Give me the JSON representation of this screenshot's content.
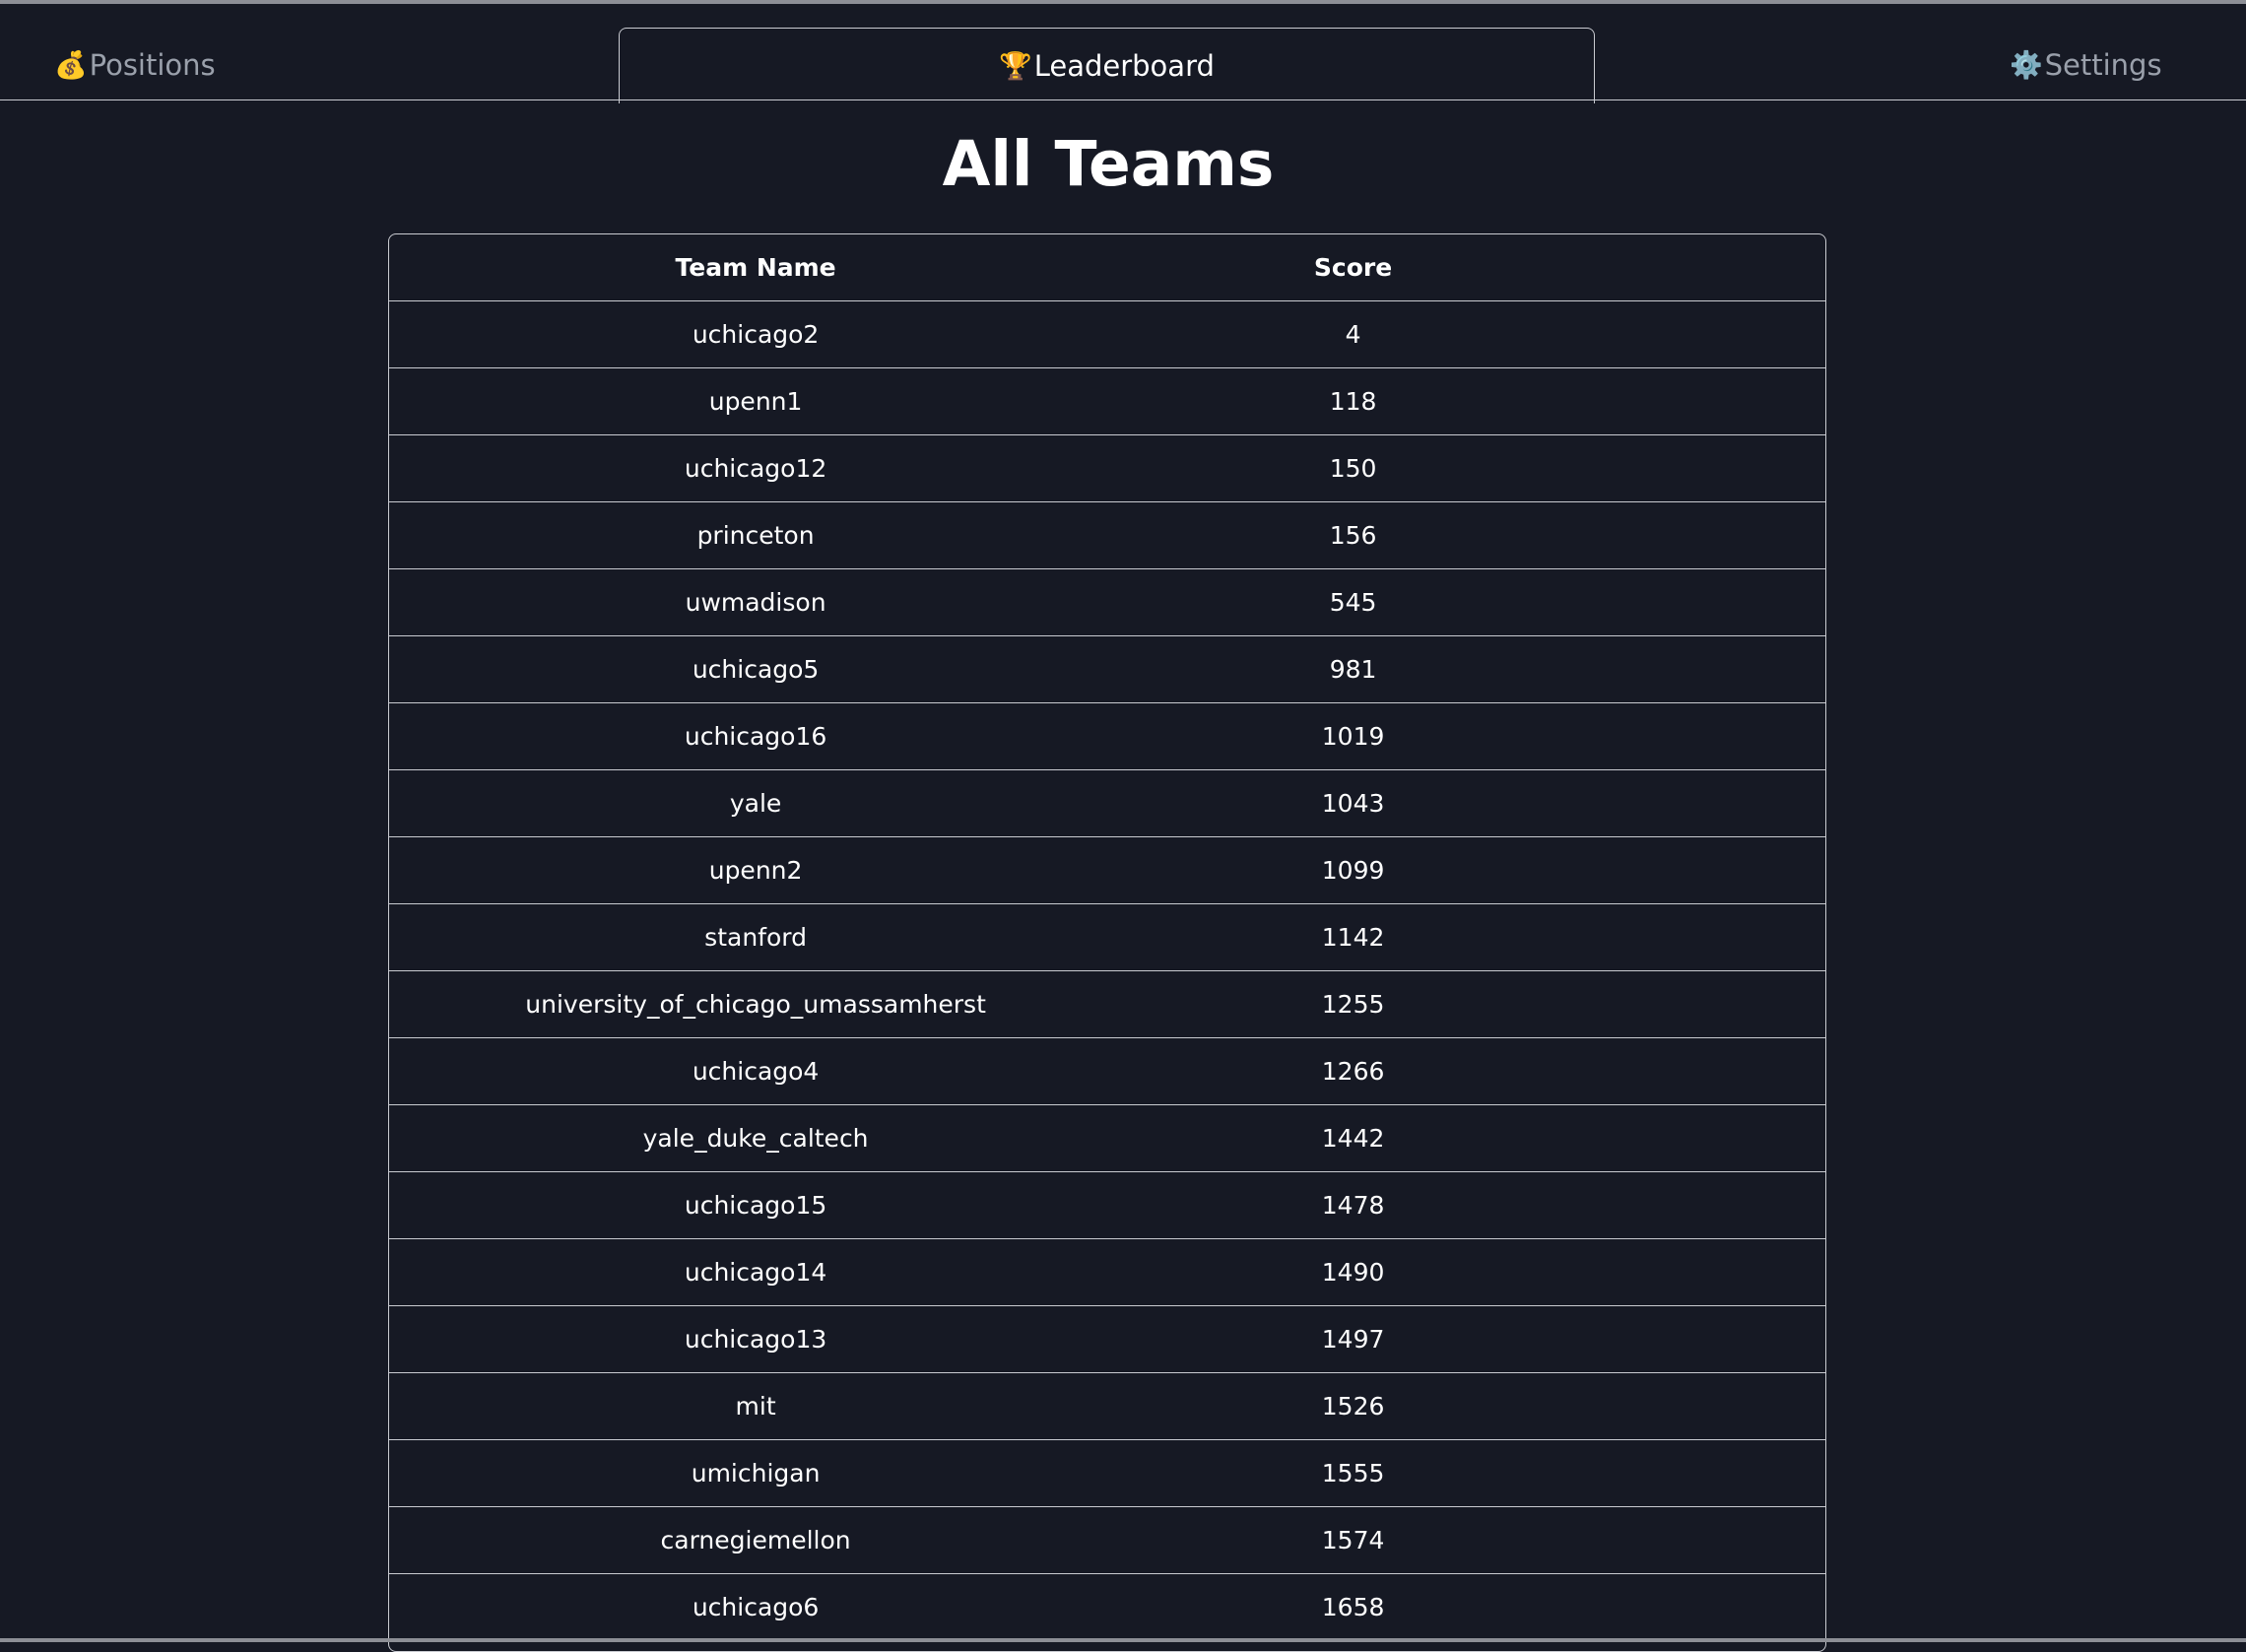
{
  "nav": {
    "tabs": [
      {
        "icon": "💰",
        "icon_name": "money-bag-icon",
        "label": "Positions",
        "active": false
      },
      {
        "icon": "🏆",
        "icon_name": "trophy-icon",
        "label": "Leaderboard",
        "active": true
      },
      {
        "icon": "⚙️",
        "icon_name": "gear-icon",
        "label": "Settings",
        "active": false
      }
    ]
  },
  "page": {
    "title": "All Teams"
  },
  "table": {
    "headers": [
      "Team Name",
      "Score"
    ],
    "rows": [
      [
        "uchicago2",
        "4"
      ],
      [
        "upenn1",
        "118"
      ],
      [
        "uchicago12",
        "150"
      ],
      [
        "princeton",
        "156"
      ],
      [
        "uwmadison",
        "545"
      ],
      [
        "uchicago5",
        "981"
      ],
      [
        "uchicago16",
        "1019"
      ],
      [
        "yale",
        "1043"
      ],
      [
        "upenn2",
        "1099"
      ],
      [
        "stanford",
        "1142"
      ],
      [
        "university_of_chicago_umassamherst",
        "1255"
      ],
      [
        "uchicago4",
        "1266"
      ],
      [
        "yale_duke_caltech",
        "1442"
      ],
      [
        "uchicago15",
        "1478"
      ],
      [
        "uchicago14",
        "1490"
      ],
      [
        "uchicago13",
        "1497"
      ],
      [
        "mit",
        "1526"
      ],
      [
        "umichigan",
        "1555"
      ],
      [
        "carnegiemellon",
        "1574"
      ],
      [
        "uchicago6",
        "1658"
      ]
    ]
  },
  "colors": {
    "background": "#161924",
    "border": "#c9cbd1",
    "inactive_tab": "#9aa0ab",
    "text": "#ffffff"
  }
}
